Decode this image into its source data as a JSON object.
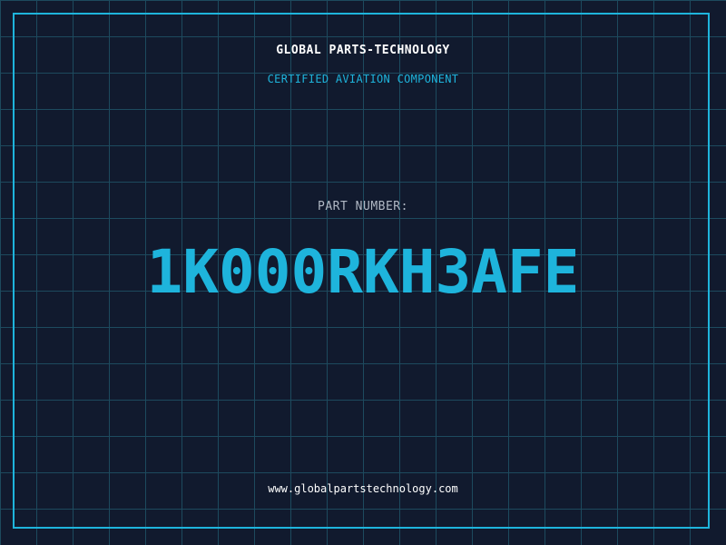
{
  "header": {
    "company": "GLOBAL PARTS-TECHNOLOGY",
    "tagline": "CERTIFIED AVIATION COMPONENT"
  },
  "part": {
    "label": "PART NUMBER:",
    "number": "1K000RKH3AFE"
  },
  "footer": {
    "website": "www.globalpartstechnology.com"
  },
  "colors": {
    "background": "#111a2e",
    "grid": "#1d4a5e",
    "accent": "#1eb4dc",
    "text_primary": "#ffffff",
    "text_secondary": "#b0b8c4"
  }
}
